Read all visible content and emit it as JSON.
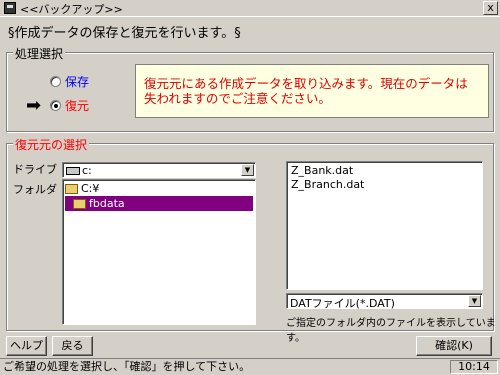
{
  "window": {
    "title": "<<バックアップ>>",
    "close_label": "x"
  },
  "header": {
    "text": "§作成データの保存と復元を行います。§"
  },
  "process_group": {
    "title": "処理選択",
    "options": [
      {
        "label": "保存",
        "color": "#0000ff",
        "selected": false
      },
      {
        "label": "復元",
        "color": "#ff0000",
        "selected": true
      }
    ],
    "info": "復元元にある作成データを取り込みます。現在のデータは失われますのでご注意ください。"
  },
  "restore_group": {
    "title": "復元元の選択",
    "drive_label": "ドライブ",
    "folder_label": "フォルダ",
    "drive_value": "c:",
    "folders": [
      {
        "label": "C:¥",
        "selected": false
      },
      {
        "label": "fbdata",
        "selected": true
      }
    ],
    "files": [
      "Z_Bank.dat",
      "Z_Branch.dat"
    ],
    "filetype_value": "DATファイル(*.DAT)",
    "folder_hint": "ご指定のフォルダ内のファイルを表示しています。"
  },
  "buttons": {
    "help": "ヘルプ",
    "back": "戻る",
    "confirm": "確認(K)"
  },
  "status": {
    "message": "ご希望の処理を選択し、「確認」を押して下さい。",
    "time": "10:14"
  },
  "colors": {
    "accent_red": "#ff0000",
    "selection_purple": "#800080",
    "info_bg": "#ffffe1"
  }
}
